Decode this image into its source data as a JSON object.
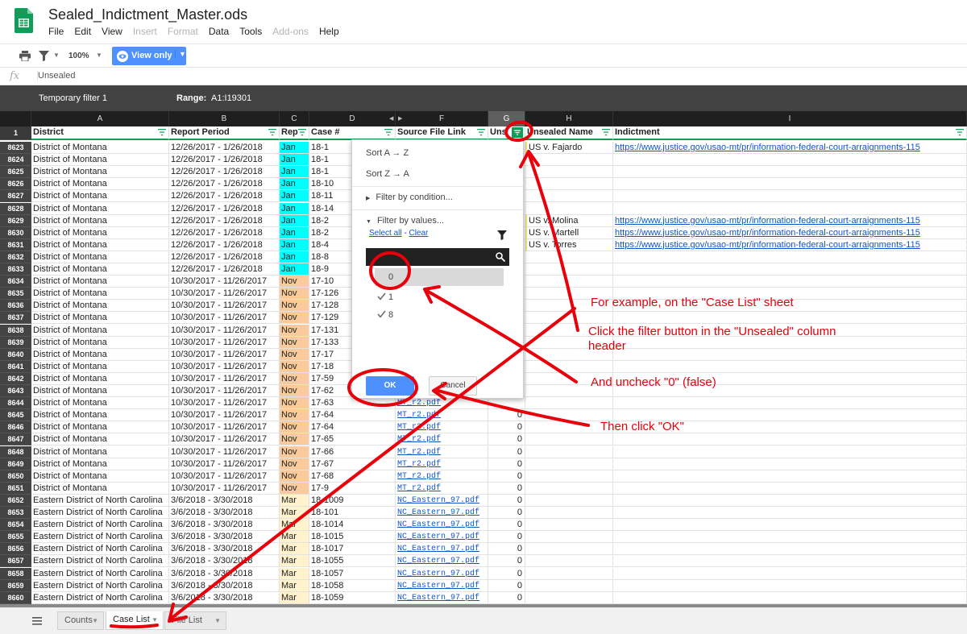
{
  "app": {
    "doc_title": "Sealed_Indictment_Master.ods",
    "menus": [
      {
        "label": "File",
        "enabled": true
      },
      {
        "label": "Edit",
        "enabled": true
      },
      {
        "label": "View",
        "enabled": true
      },
      {
        "label": "Insert",
        "enabled": false
      },
      {
        "label": "Format",
        "enabled": false
      },
      {
        "label": "Data",
        "enabled": true
      },
      {
        "label": "Tools",
        "enabled": true
      },
      {
        "label": "Add-ons",
        "enabled": false
      },
      {
        "label": "Help",
        "enabled": true
      }
    ],
    "accent": "#0f9d58"
  },
  "toolbar": {
    "zoom": "100%",
    "view_only": "View only"
  },
  "formula": {
    "fx": "fx",
    "value": "Unsealed"
  },
  "filterbar": {
    "name": "Temporary filter 1",
    "range_label": "Range:",
    "range_value": "A1:I19301"
  },
  "columns": [
    "A",
    "B",
    "C",
    "D",
    "E",
    "F",
    "G",
    "H",
    "I"
  ],
  "header_row": {
    "rownum": "1",
    "cells": [
      "District",
      "Report Period",
      "Rep",
      "Case #",
      "Source File Link",
      "Uns",
      "Unsealed Name",
      "Indictment"
    ]
  },
  "rows": [
    {
      "n": "8623",
      "district": "District of Montana",
      "period": "12/26/2017 - 1/26/2018",
      "rep": "Jan",
      "case": "18-1",
      "file": "",
      "uns": "",
      "name": "US v. Fajardo",
      "link": "https://www.justice.gov/usao-mt/pr/information-federal-court-arraignments-115"
    },
    {
      "n": "8624",
      "district": "District of Montana",
      "period": "12/26/2017 - 1/26/2018",
      "rep": "Jan",
      "case": "18-1",
      "file": "",
      "uns": "",
      "name": "",
      "link": ""
    },
    {
      "n": "8625",
      "district": "District of Montana",
      "period": "12/26/2017 - 1/26/2018",
      "rep": "Jan",
      "case": "18-1",
      "file": "",
      "uns": "",
      "name": "",
      "link": ""
    },
    {
      "n": "8626",
      "district": "District of Montana",
      "period": "12/26/2017 - 1/26/2018",
      "rep": "Jan",
      "case": "18-10",
      "file": "",
      "uns": "",
      "name": "",
      "link": ""
    },
    {
      "n": "8627",
      "district": "District of Montana",
      "period": "12/26/2017 - 1/26/2018",
      "rep": "Jan",
      "case": "18-11",
      "file": "",
      "uns": "",
      "name": "",
      "link": ""
    },
    {
      "n": "8628",
      "district": "District of Montana",
      "period": "12/26/2017 - 1/26/2018",
      "rep": "Jan",
      "case": "18-14",
      "file": "",
      "uns": "",
      "name": "",
      "link": ""
    },
    {
      "n": "8629",
      "district": "District of Montana",
      "period": "12/26/2017 - 1/26/2018",
      "rep": "Jan",
      "case": "18-2",
      "file": "",
      "uns": "",
      "name": "US v. Molina",
      "link": "https://www.justice.gov/usao-mt/pr/information-federal-court-arraignments-115"
    },
    {
      "n": "8630",
      "district": "District of Montana",
      "period": "12/26/2017 - 1/26/2018",
      "rep": "Jan",
      "case": "18-2",
      "file": "",
      "uns": "",
      "name": "US v. Martell",
      "link": "https://www.justice.gov/usao-mt/pr/information-federal-court-arraignments-115"
    },
    {
      "n": "8631",
      "district": "District of Montana",
      "period": "12/26/2017 - 1/26/2018",
      "rep": "Jan",
      "case": "18-4",
      "file": "",
      "uns": "",
      "name": "US v. Torres",
      "link": "https://www.justice.gov/usao-mt/pr/information-federal-court-arraignments-115"
    },
    {
      "n": "8632",
      "district": "District of Montana",
      "period": "12/26/2017 - 1/26/2018",
      "rep": "Jan",
      "case": "18-8",
      "file": "",
      "uns": "",
      "name": "",
      "link": ""
    },
    {
      "n": "8633",
      "district": "District of Montana",
      "period": "12/26/2017 - 1/26/2018",
      "rep": "Jan",
      "case": "18-9",
      "file": "",
      "uns": "",
      "name": "",
      "link": ""
    },
    {
      "n": "8634",
      "district": "District of Montana",
      "period": "10/30/2017 - 11/26/2017",
      "rep": "Nov",
      "case": "17-10",
      "file": "",
      "uns": "",
      "name": "",
      "link": ""
    },
    {
      "n": "8635",
      "district": "District of Montana",
      "period": "10/30/2017 - 11/26/2017",
      "rep": "Nov",
      "case": "17-126",
      "file": "",
      "uns": "",
      "name": "",
      "link": ""
    },
    {
      "n": "8636",
      "district": "District of Montana",
      "period": "10/30/2017 - 11/26/2017",
      "rep": "Nov",
      "case": "17-128",
      "file": "",
      "uns": "",
      "name": "",
      "link": ""
    },
    {
      "n": "8637",
      "district": "District of Montana",
      "period": "10/30/2017 - 11/26/2017",
      "rep": "Nov",
      "case": "17-129",
      "file": "",
      "uns": "",
      "name": "",
      "link": ""
    },
    {
      "n": "8638",
      "district": "District of Montana",
      "period": "10/30/2017 - 11/26/2017",
      "rep": "Nov",
      "case": "17-131",
      "file": "",
      "uns": "",
      "name": "",
      "link": ""
    },
    {
      "n": "8639",
      "district": "District of Montana",
      "period": "10/30/2017 - 11/26/2017",
      "rep": "Nov",
      "case": "17-133",
      "file": "",
      "uns": "",
      "name": "",
      "link": ""
    },
    {
      "n": "8640",
      "district": "District of Montana",
      "period": "10/30/2017 - 11/26/2017",
      "rep": "Nov",
      "case": "17-17",
      "file": "",
      "uns": "",
      "name": "",
      "link": ""
    },
    {
      "n": "8641",
      "district": "District of Montana",
      "period": "10/30/2017 - 11/26/2017",
      "rep": "Nov",
      "case": "17-18",
      "file": "",
      "uns": "",
      "name": "",
      "link": ""
    },
    {
      "n": "8642",
      "district": "District of Montana",
      "period": "10/30/2017 - 11/26/2017",
      "rep": "Nov",
      "case": "17-59",
      "file": "",
      "uns": "",
      "name": "",
      "link": ""
    },
    {
      "n": "8643",
      "district": "District of Montana",
      "period": "10/30/2017 - 11/26/2017",
      "rep": "Nov",
      "case": "17-62",
      "file": "",
      "uns": "",
      "name": "",
      "link": ""
    },
    {
      "n": "8644",
      "district": "District of Montana",
      "period": "10/30/2017 - 11/26/2017",
      "rep": "Nov",
      "case": "17-63",
      "file": "MT_r2.pdf",
      "uns": "",
      "name": "",
      "link": ""
    },
    {
      "n": "8645",
      "district": "District of Montana",
      "period": "10/30/2017 - 11/26/2017",
      "rep": "Nov",
      "case": "17-64",
      "file": "MT_r2.pdf",
      "uns": "0",
      "name": "",
      "link": ""
    },
    {
      "n": "8646",
      "district": "District of Montana",
      "period": "10/30/2017 - 11/26/2017",
      "rep": "Nov",
      "case": "17-64",
      "file": "MT_r2.pdf",
      "uns": "0",
      "name": "",
      "link": ""
    },
    {
      "n": "8647",
      "district": "District of Montana",
      "period": "10/30/2017 - 11/26/2017",
      "rep": "Nov",
      "case": "17-65",
      "file": "MT_r2.pdf",
      "uns": "0",
      "name": "",
      "link": ""
    },
    {
      "n": "8648",
      "district": "District of Montana",
      "period": "10/30/2017 - 11/26/2017",
      "rep": "Nov",
      "case": "17-66",
      "file": "MT_r2.pdf",
      "uns": "0",
      "name": "",
      "link": ""
    },
    {
      "n": "8649",
      "district": "District of Montana",
      "period": "10/30/2017 - 11/26/2017",
      "rep": "Nov",
      "case": "17-67",
      "file": "MT_r2.pdf",
      "uns": "0",
      "name": "",
      "link": ""
    },
    {
      "n": "8650",
      "district": "District of Montana",
      "period": "10/30/2017 - 11/26/2017",
      "rep": "Nov",
      "case": "17-68",
      "file": "MT_r2.pdf",
      "uns": "0",
      "name": "",
      "link": ""
    },
    {
      "n": "8651",
      "district": "District of Montana",
      "period": "10/30/2017 - 11/26/2017",
      "rep": "Nov",
      "case": "17-9",
      "file": "MT_r2.pdf",
      "uns": "0",
      "name": "",
      "link": ""
    },
    {
      "n": "8652",
      "district": "Eastern District of North Carolina",
      "period": "3/6/2018 - 3/30/2018",
      "rep": "Mar",
      "case": "18-1009",
      "file": "NC_Eastern_97.pdf",
      "uns": "0",
      "name": "",
      "link": ""
    },
    {
      "n": "8653",
      "district": "Eastern District of North Carolina",
      "period": "3/6/2018 - 3/30/2018",
      "rep": "Mar",
      "case": "18-101",
      "file": "NC_Eastern_97.pdf",
      "uns": "0",
      "name": "",
      "link": ""
    },
    {
      "n": "8654",
      "district": "Eastern District of North Carolina",
      "period": "3/6/2018 - 3/30/2018",
      "rep": "Mar",
      "case": "18-1014",
      "file": "NC_Eastern_97.pdf",
      "uns": "0",
      "name": "",
      "link": ""
    },
    {
      "n": "8655",
      "district": "Eastern District of North Carolina",
      "period": "3/6/2018 - 3/30/2018",
      "rep": "Mar",
      "case": "18-1015",
      "file": "NC_Eastern_97.pdf",
      "uns": "0",
      "name": "",
      "link": ""
    },
    {
      "n": "8656",
      "district": "Eastern District of North Carolina",
      "period": "3/6/2018 - 3/30/2018",
      "rep": "Mar",
      "case": "18-1017",
      "file": "NC_Eastern_97.pdf",
      "uns": "0",
      "name": "",
      "link": ""
    },
    {
      "n": "8657",
      "district": "Eastern District of North Carolina",
      "period": "3/6/2018 - 3/30/2018",
      "rep": "Mar",
      "case": "18-1055",
      "file": "NC_Eastern_97.pdf",
      "uns": "0",
      "name": "",
      "link": ""
    },
    {
      "n": "8658",
      "district": "Eastern District of North Carolina",
      "period": "3/6/2018 - 3/30/2018",
      "rep": "Mar",
      "case": "18-1057",
      "file": "NC_Eastern_97.pdf",
      "uns": "0",
      "name": "",
      "link": ""
    },
    {
      "n": "8659",
      "district": "Eastern District of North Carolina",
      "period": "3/6/2018 - 3/30/2018",
      "rep": "Mar",
      "case": "18-1058",
      "file": "NC_Eastern_97.pdf",
      "uns": "0",
      "name": "",
      "link": ""
    },
    {
      "n": "8660",
      "district": "Eastern District of North Carolina",
      "period": "3/6/2018 - 3/30/2018",
      "rep": "Mar",
      "case": "18-1059",
      "file": "NC_Eastern_97.pdf",
      "uns": "0",
      "name": "",
      "link": ""
    }
  ],
  "rep_colors": {
    "Jan": "#00ffff",
    "Nov": "#f9cb9c",
    "Mar": "#fff2cc"
  },
  "popup": {
    "sort_az": "Sort A → Z",
    "sort_za": "Sort Z → A",
    "filter_condition": "Filter by condition...",
    "filter_values": "Filter by values...",
    "select_all": "Select all",
    "separator": " - ",
    "clear": "Clear",
    "values": [
      {
        "label": "0",
        "checked": false
      },
      {
        "label": "1",
        "checked": true
      },
      {
        "label": "8",
        "checked": true
      }
    ],
    "ok": "OK",
    "cancel": "Cancel"
  },
  "tabs": [
    {
      "label": "Counts",
      "active": false
    },
    {
      "label": "Case List",
      "active": true
    },
    {
      "label": "File List",
      "active": false
    }
  ],
  "annotations": {
    "color": "#e8000b",
    "note1": "For example, on the \"Case List\" sheet",
    "note2a": "Click the filter button in the \"Unsealed\" column",
    "note2b": "header",
    "note3": "And uncheck \"0\" (false)",
    "note4": "Then click \"OK\""
  }
}
